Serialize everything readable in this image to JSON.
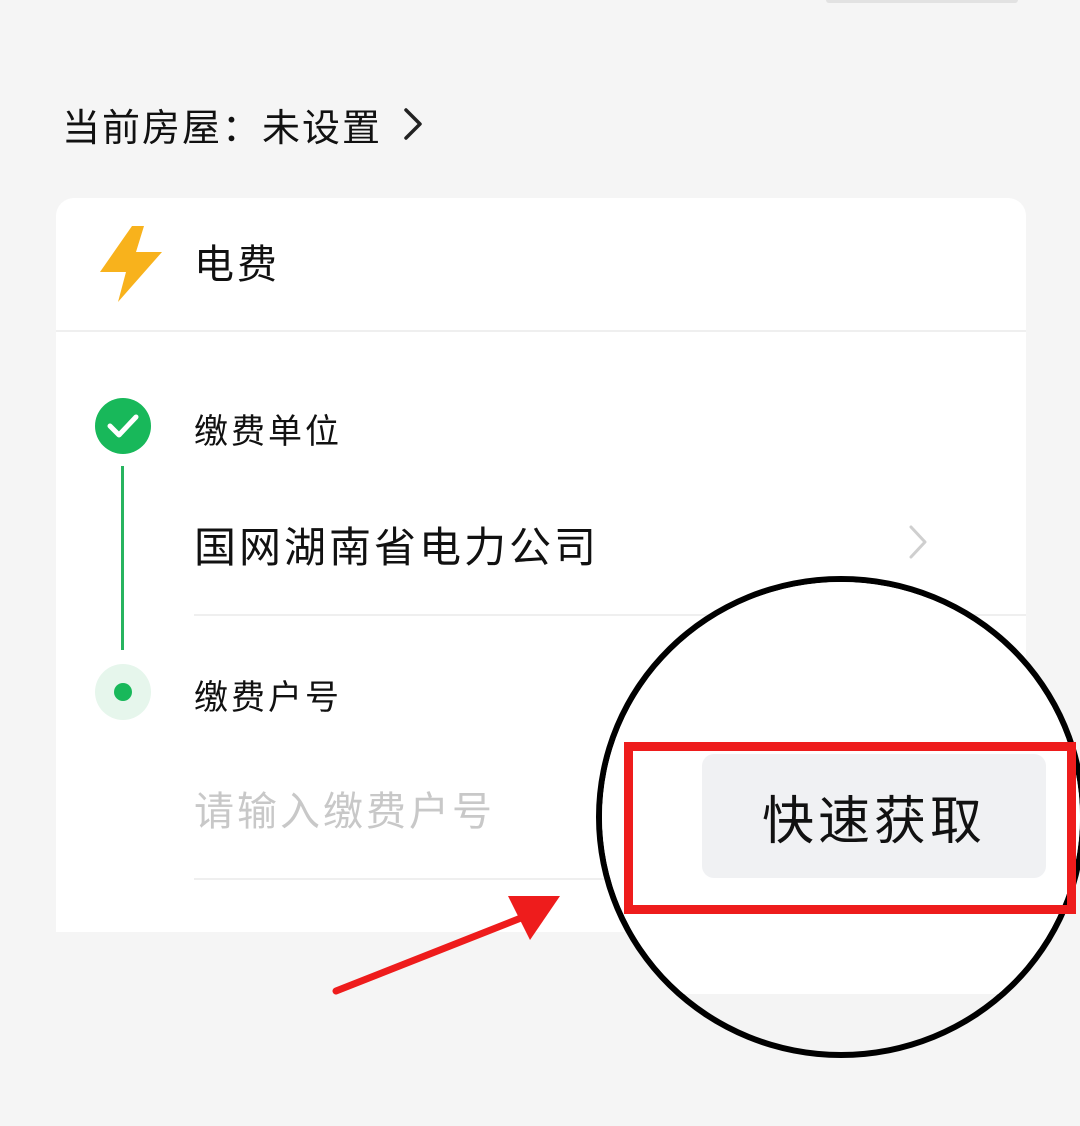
{
  "header": {
    "house_label": "当前房屋：",
    "house_value": "未设置",
    "chevron_icon": "chevron-right-icon"
  },
  "card": {
    "title": "电费",
    "title_icon": "lightning-bolt-icon",
    "accent_color": "#f8b21c",
    "steps": [
      {
        "label": "缴费单位",
        "status": "done",
        "value": "国网湖南省电力公司"
      },
      {
        "label": "缴费户号",
        "status": "active",
        "placeholder": "请输入缴费户号"
      }
    ],
    "success_color": "#18b85a"
  },
  "magnifier": {
    "quick_button_label": "快速获取"
  },
  "annotation": {
    "highlight_color": "#ee1c1c"
  }
}
